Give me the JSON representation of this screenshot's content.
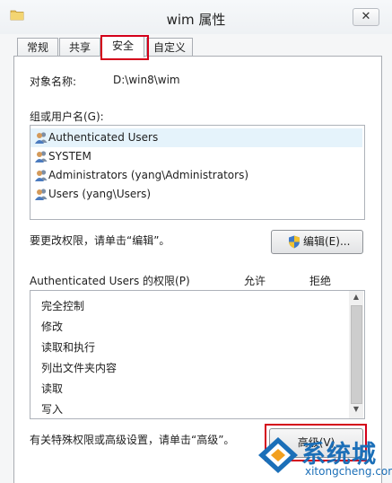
{
  "window": {
    "title": "wim 属性",
    "close_label": "✕"
  },
  "tabs": [
    {
      "label": "常规"
    },
    {
      "label": "共享"
    },
    {
      "label": "安全"
    },
    {
      "label": "自定义"
    }
  ],
  "object": {
    "label": "对象名称:",
    "value": "D:\\win8\\wim"
  },
  "groups": {
    "label": "组或用户名(G):",
    "items": [
      {
        "label": "Authenticated Users"
      },
      {
        "label": "SYSTEM"
      },
      {
        "label": "Administrators (yang\\Administrators)"
      },
      {
        "label": "Users (yang\\Users)"
      }
    ]
  },
  "edit": {
    "hint": "要更改权限，请单击“编辑”。",
    "button_label": "编辑(E)..."
  },
  "permissions": {
    "title": "Authenticated Users 的权限(P)",
    "allow_header": "允许",
    "deny_header": "拒绝",
    "items": [
      {
        "label": "完全控制"
      },
      {
        "label": "修改"
      },
      {
        "label": "读取和执行"
      },
      {
        "label": "列出文件夹内容"
      },
      {
        "label": "读取"
      },
      {
        "label": "写入"
      }
    ]
  },
  "advanced": {
    "hint": "有关特殊权限或高级设置，请单击“高级”。",
    "button_label": "高级(V)"
  },
  "watermark": {
    "brand": "系统城",
    "url": "xitongcheng.com"
  },
  "colors": {
    "highlight_red": "#d4001a",
    "selection_blue": "#e5f3fb",
    "watermark_blue": "#1b6fb8"
  }
}
